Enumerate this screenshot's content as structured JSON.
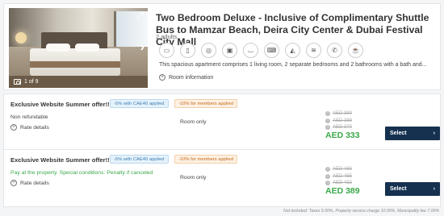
{
  "room": {
    "title": "Two Bedroom Deluxe - Inclusive of Complimentary Shuttle Bus to Mamzar Beach, Deira City Center & Dubai Festival City Mall",
    "guests": "2 adults",
    "description": "This spacious apartment comprises 1 living room, 2 separate bedrooms and 2 bathrooms with a bath and...",
    "room_info_label": "Room information",
    "photo_counter": "1 of 9",
    "amenities": [
      "microwave-icon",
      "fridge-icon",
      "washer-icon",
      "tv-icon",
      "bathtub-icon",
      "laptop-icon",
      "iron-icon",
      "air-conditioning-icon",
      "phone-icon",
      "coffee-maker-icon"
    ]
  },
  "rates": [
    {
      "offer_title": "Exclusive Website Summer offer!!",
      "badge_discount": "-5% with CAE40 applied",
      "badge_members": "-10% for members applied",
      "policy": "Non refundable",
      "rate_details_label": "Rate details",
      "board": "Room only",
      "strike_prices": [
        "AED 390",
        "AED 389",
        "AED 370"
      ],
      "price": "AED 333",
      "select_label": "Select"
    },
    {
      "offer_title": "Exclusive Website Summer offer!!",
      "badge_discount": "-5% with CAE40 applied",
      "badge_members": "-10% for members applied",
      "policy": "Pay at the property. Special conditions: Penalty if canceled",
      "rate_details_label": "Rate details",
      "board": "Room only",
      "strike_prices": [
        "AED 480",
        "AED 455",
        "AED 432"
      ],
      "price": "AED 389",
      "select_label": "Select"
    }
  ],
  "footer_note": "Not included: Taxes 5.00%, Property service charge 10.00%, Municipality fee 7.00%",
  "colors": {
    "price_green": "#3aa84a",
    "button_navy": "#15314f"
  }
}
